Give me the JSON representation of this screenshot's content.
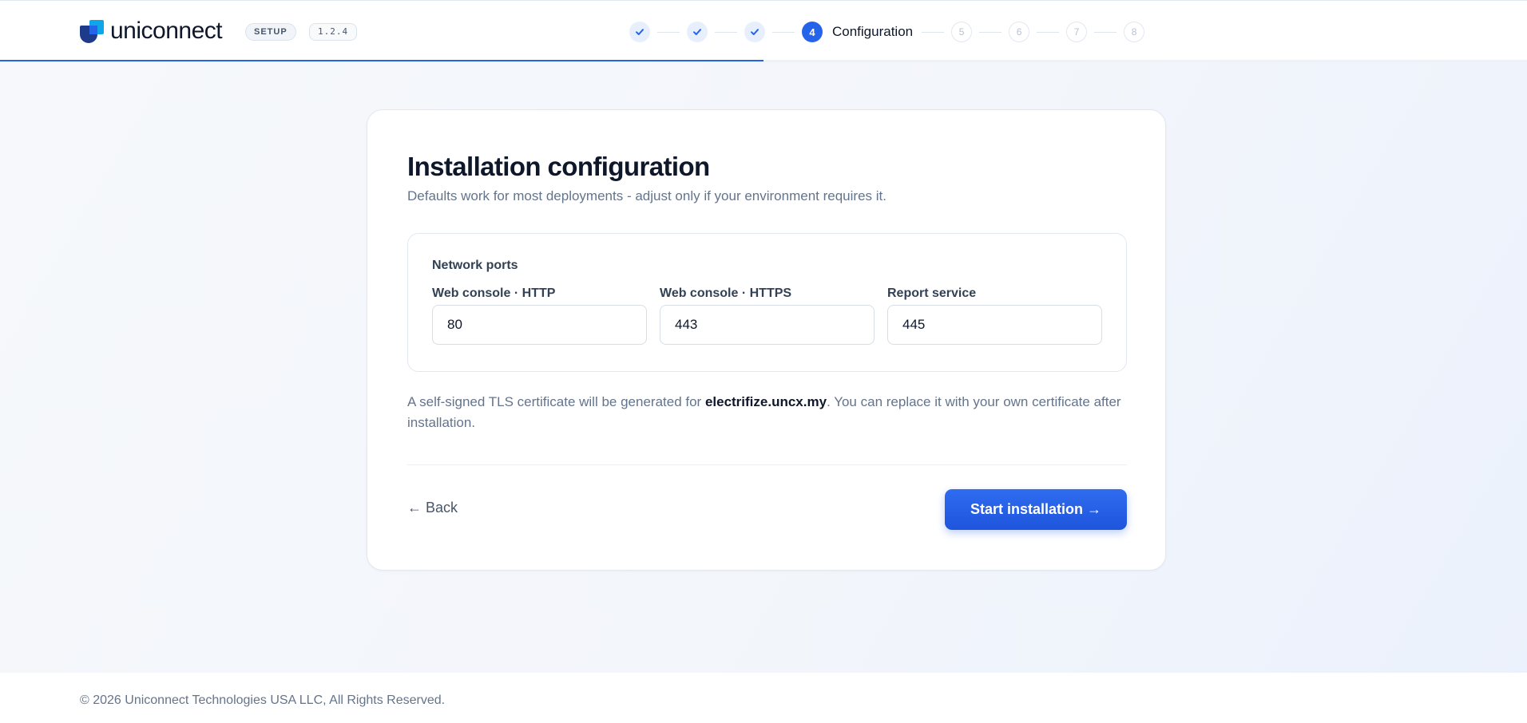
{
  "brand": {
    "name": "uniconnect",
    "badge": "SETUP",
    "version": "1.2.4"
  },
  "colors": {
    "accent": "#2563eb",
    "text": "#0f172a",
    "muted": "#64748b"
  },
  "progress": {
    "completed_fraction": 0.5
  },
  "stepper": {
    "done_icon": "check-icon",
    "steps": [
      {
        "number": "1",
        "state": "done"
      },
      {
        "number": "2",
        "state": "done"
      },
      {
        "number": "3",
        "state": "done"
      },
      {
        "number": "4",
        "state": "current",
        "label": "Configuration"
      },
      {
        "number": "5",
        "state": "future"
      },
      {
        "number": "6",
        "state": "future"
      },
      {
        "number": "7",
        "state": "future"
      },
      {
        "number": "8",
        "state": "future"
      }
    ]
  },
  "main": {
    "title": "Installation configuration",
    "subtitle": "Defaults work for most deployments - adjust only if your environment requires it.",
    "ports": {
      "heading": "Network ports",
      "fields": [
        {
          "label": "Web console · HTTP",
          "value": "80"
        },
        {
          "label": "Web console · HTTPS",
          "value": "443"
        },
        {
          "label": "Report service",
          "value": "445"
        }
      ]
    },
    "note": {
      "prefix": "A self-signed TLS certificate will be generated for ",
      "domain": "electrifize.uncx.my",
      "suffix": ". You can replace it with your own certificate after installation."
    },
    "actions": {
      "back_label": "← Back",
      "start_label": "Start installation →"
    }
  },
  "footer": {
    "copyright": "© 2026 Uniconnect Technologies USA LLC, All Rights Reserved."
  }
}
